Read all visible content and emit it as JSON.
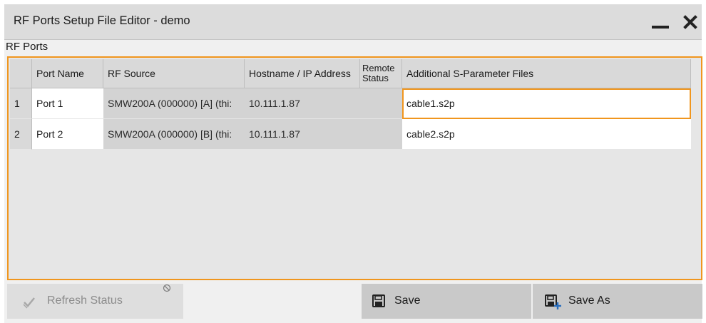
{
  "window": {
    "title": "RF Ports Setup File Editor - demo",
    "minimize_icon": "minimize-icon",
    "close_icon": "close-icon"
  },
  "section": {
    "label": "RF Ports"
  },
  "table": {
    "headers": {
      "port_name": "Port Name",
      "rf_source": "RF Source",
      "host": "Hostname / IP Address",
      "remote_status": "Remote Status",
      "sparam": "Additional S-Parameter Files"
    },
    "rows": [
      {
        "num": "1",
        "port_name": "Port 1",
        "rf_source": "SMW200A (000000)  [A]  (thi:",
        "host": "10.111.1.87",
        "remote_status": "",
        "sparam": "cable1.s2p",
        "selected": true
      },
      {
        "num": "2",
        "port_name": "Port 2",
        "rf_source": "SMW200A (000000)  [B]  (thi:",
        "host": "10.111.1.87",
        "remote_status": "",
        "sparam": "cable2.s2p",
        "selected": false
      }
    ]
  },
  "buttons": {
    "refresh": {
      "label": "Refresh Status",
      "icon": "refresh-check-icon",
      "enabled": false
    },
    "save": {
      "label": "Save",
      "icon": "floppy-disk-icon"
    },
    "save_as": {
      "label": "Save As",
      "icon": "floppy-disk-plus-icon"
    }
  },
  "colors": {
    "accent": "#f0961e",
    "titlebar": "#dcdcdc",
    "button": "#c9c9c9",
    "cell_readonly": "#d3d3d3"
  }
}
